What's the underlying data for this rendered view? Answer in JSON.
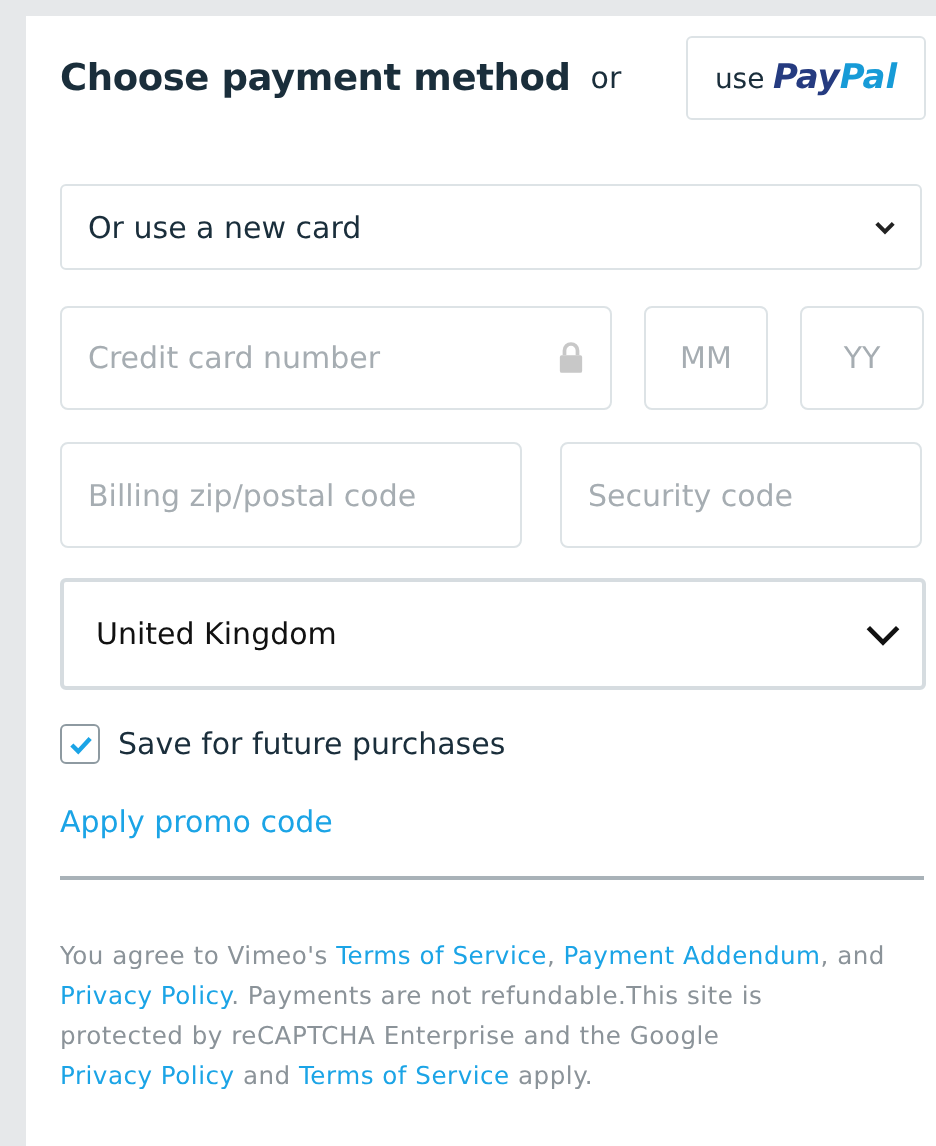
{
  "header": {
    "title": "Choose payment method",
    "or": "or",
    "paypal": {
      "prefix": "use",
      "brand": [
        {
          "text": "Pay",
          "color": "#253b80"
        },
        {
          "text": "Pal",
          "color": "#179bd7"
        }
      ]
    }
  },
  "card_select": {
    "value": "Or use a new card"
  },
  "fields": [
    {
      "placeholder": "Credit card number",
      "kind": "card"
    },
    {
      "placeholder": "MM",
      "kind": "short"
    },
    {
      "placeholder": "YY",
      "kind": "short"
    }
  ],
  "fields_row2": [
    {
      "placeholder": "Billing zip/postal code"
    },
    {
      "placeholder": "Security code"
    }
  ],
  "country_select": {
    "value": "United Kingdom"
  },
  "save_checkbox": {
    "label": "Save for future purchases",
    "checked": true
  },
  "promo_link": "Apply promo code",
  "legal": [
    {
      "kind": "text",
      "text": "You agree to Vimeo's "
    },
    {
      "kind": "link",
      "text": "Terms of Service"
    },
    {
      "kind": "text",
      "text": ", "
    },
    {
      "kind": "link",
      "text": "Payment Addendum"
    },
    {
      "kind": "text",
      "text": ", and "
    },
    {
      "kind": "link",
      "text": "Privacy Policy"
    },
    {
      "kind": "text",
      "text": ". Payments are not refundable.This site is protected by reCAPTCHA Enterprise and the Google "
    },
    {
      "kind": "link",
      "text": "Privacy Policy"
    },
    {
      "kind": "text",
      "text": " and "
    },
    {
      "kind": "link",
      "text": "Terms of Service"
    },
    {
      "kind": "text",
      "text": " apply."
    }
  ]
}
